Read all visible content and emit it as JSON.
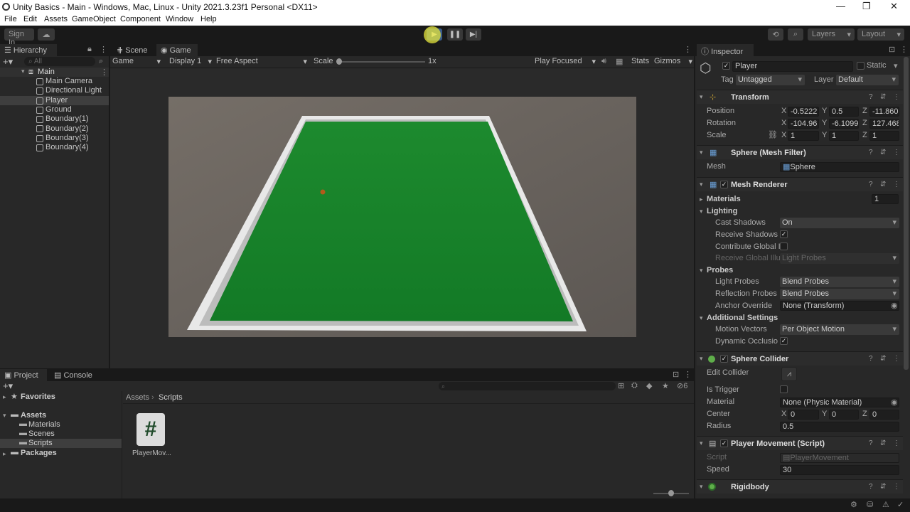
{
  "window": {
    "title": "Unity Basics - Main - Windows, Mac, Linux - Unity 2021.3.23f1 Personal <DX11>"
  },
  "menu": [
    "File",
    "Edit",
    "Assets",
    "GameObject",
    "Component",
    "Window",
    "Help"
  ],
  "toolbar": {
    "sign_in": "Sign In",
    "layers": "Layers",
    "layout": "Layout"
  },
  "hierarchy": {
    "tab": "Hierarchy",
    "search_placeholder": "All",
    "scene": "Main",
    "items": [
      "Main Camera",
      "Directional Light",
      "Player",
      "Ground",
      "Boundary(1)",
      "Boundary(2)",
      "Boundary(3)",
      "Boundary(4)"
    ]
  },
  "game_view": {
    "tabs": [
      "Scene",
      "Game"
    ],
    "mode": "Game",
    "display": "Display 1",
    "aspect": "Free Aspect",
    "scale_label": "Scale",
    "scale_value": "1x",
    "play_focused": "Play Focused",
    "stats": "Stats",
    "gizmos": "Gizmos"
  },
  "project": {
    "tabs": [
      "Project",
      "Console"
    ],
    "favorites": "Favorites",
    "assets": "Assets",
    "folders": [
      "Materials",
      "Scenes",
      "Scripts"
    ],
    "packages": "Packages",
    "breadcrumb": [
      "Assets",
      "Scripts"
    ],
    "file": "PlayerMov...",
    "count": "6"
  },
  "inspector": {
    "tab": "Inspector",
    "object_name": "Player",
    "static": "Static",
    "tag_label": "Tag",
    "tag": "Untagged",
    "layer_label": "Layer",
    "layer": "Default",
    "transform": {
      "title": "Transform",
      "position_label": "Position",
      "rotation_label": "Rotation",
      "scale_label": "Scale",
      "position": [
        "-0.5222",
        "0.5",
        "-11.860"
      ],
      "rotation": [
        "-104.96",
        "-6.1099",
        "127.468"
      ],
      "scale": [
        "1",
        "1",
        "1"
      ]
    },
    "mesh_filter": {
      "title": "Sphere (Mesh Filter)",
      "mesh_label": "Mesh",
      "mesh": "Sphere"
    },
    "mesh_renderer": {
      "title": "Mesh Renderer",
      "materials": "Materials",
      "materials_count": "1",
      "lighting": "Lighting",
      "cast_shadows": "Cast Shadows",
      "cast_shadows_value": "On",
      "receive_shadows": "Receive Shadows",
      "contribute_gi": "Contribute Global I",
      "receive_gi": "Receive Global Illu",
      "receive_gi_value": "Light Probes",
      "probes": "Probes",
      "light_probes": "Light Probes",
      "light_probes_value": "Blend Probes",
      "reflection_probes": "Reflection Probes",
      "reflection_probes_value": "Blend Probes",
      "anchor_override": "Anchor Override",
      "anchor_override_value": "None (Transform)",
      "additional": "Additional Settings",
      "motion_vectors": "Motion Vectors",
      "motion_vectors_value": "Per Object Motion",
      "dynamic_occlusion": "Dynamic Occlusio"
    },
    "sphere_collider": {
      "title": "Sphere Collider",
      "edit_collider": "Edit Collider",
      "is_trigger": "Is Trigger",
      "material": "Material",
      "material_value": "None (Physic Material)",
      "center": "Center",
      "center_values": [
        "0",
        "0",
        "0"
      ],
      "radius": "Radius",
      "radius_value": "0.5"
    },
    "player_movement": {
      "title": "Player Movement (Script)",
      "script": "Script",
      "script_value": "PlayerMovement",
      "speed": "Speed",
      "speed_value": "30"
    },
    "rigidbody": {
      "title": "Rigidbody"
    }
  }
}
